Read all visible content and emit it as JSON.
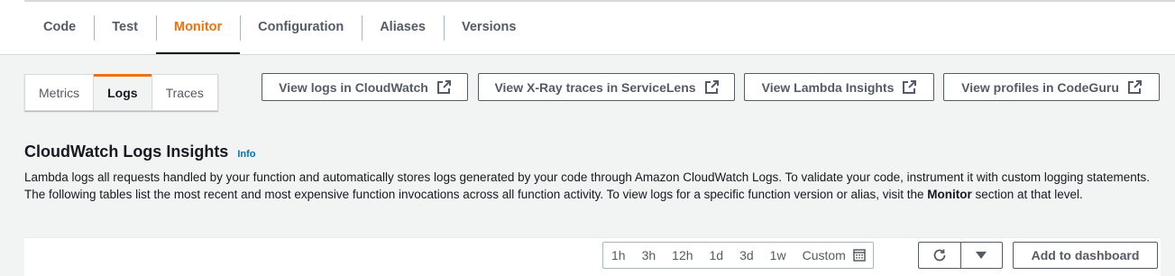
{
  "tabs": [
    {
      "label": "Code",
      "active": false
    },
    {
      "label": "Test",
      "active": false
    },
    {
      "label": "Monitor",
      "active": true
    },
    {
      "label": "Configuration",
      "active": false
    },
    {
      "label": "Aliases",
      "active": false
    },
    {
      "label": "Versions",
      "active": false
    }
  ],
  "subtabs": [
    {
      "label": "Metrics",
      "active": false
    },
    {
      "label": "Logs",
      "active": true
    },
    {
      "label": "Traces",
      "active": false
    }
  ],
  "actions": [
    {
      "label": "View logs in CloudWatch",
      "icon": "external-link-icon"
    },
    {
      "label": "View X-Ray traces in ServiceLens",
      "icon": "external-link-icon"
    },
    {
      "label": "View Lambda Insights",
      "icon": "external-link-icon"
    },
    {
      "label": "View profiles in CodeGuru",
      "icon": "external-link-icon"
    }
  ],
  "section": {
    "title": "CloudWatch Logs Insights",
    "info": "Info",
    "description_part1": "Lambda logs all requests handled by your function and automatically stores logs generated by your code through Amazon CloudWatch Logs. To validate your code, instrument it with custom logging statements. The following tables list the most recent and most expensive function invocations across all function activity. To view logs for a specific function version or alias, visit the ",
    "description_bold": "Monitor",
    "description_part2": " section at that level."
  },
  "toolbar": {
    "ranges": [
      "1h",
      "3h",
      "12h",
      "1d",
      "3d",
      "1w"
    ],
    "custom_label": "Custom",
    "refresh_icon": "refresh-icon",
    "dropdown_icon": "caret-down-icon",
    "add_label": "Add to dashboard"
  },
  "colors": {
    "accent": "#ec7211",
    "link": "#0073bb",
    "text": "#16191f",
    "secondary_text": "#545b64",
    "background": "#f2f3f3"
  }
}
